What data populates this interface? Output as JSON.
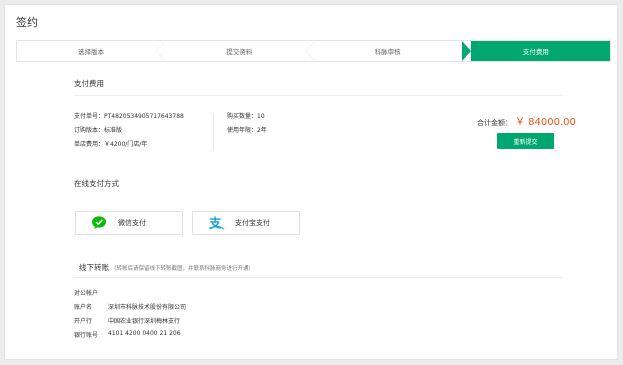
{
  "page": {
    "title": "签约"
  },
  "steps": [
    "选择版本",
    "提交资料",
    "科脉审核",
    "支付费用"
  ],
  "payment": {
    "section_title": "支付费用",
    "order_no_label": "支付单号：",
    "order_no": "PT482053490571764378​8",
    "edition_label": "订购版本：",
    "edition": "标准版",
    "unit_price_label": "单店费用：",
    "unit_price": "￥4200/门店/年",
    "qty_label": "购买数量：",
    "qty": "10",
    "years_label": "使用年限：",
    "years": "2年",
    "total_label": "合计金额：",
    "total": "￥ 84000.00",
    "resubmit_label": "重新提交"
  },
  "online": {
    "section_title": "在线支付方式",
    "wechat_label": "微信支付",
    "alipay_label": "支付宝支付"
  },
  "offline": {
    "section_title": "线下转账",
    "note": "（转账后请保留线下转账截图，并联系科脉商务进行开通）",
    "account_type": "对公帐户",
    "name_label": "账户名",
    "name": "深圳市科脉技术股份有限公司",
    "bank_label": "开户行",
    "bank": "中国农业银行深圳梅林支行",
    "number_label": "银行账号",
    "number": "4101 4200 0400 21 206"
  },
  "colors": {
    "accent": "#00a870",
    "amount": "#e8541e",
    "wechat": "#09bb07",
    "alipay": "#1a9fe0"
  },
  "icons": {
    "wechat": "wechat-icon",
    "alipay": "alipay-icon"
  }
}
